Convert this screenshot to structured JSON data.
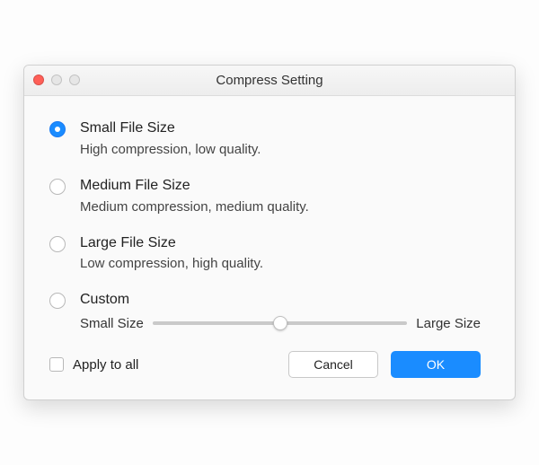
{
  "window": {
    "title": "Compress Setting"
  },
  "options": [
    {
      "label": "Small File Size",
      "desc": "High compression, low quality.",
      "selected": true
    },
    {
      "label": "Medium File Size",
      "desc": "Medium compression, medium quality.",
      "selected": false
    },
    {
      "label": "Large File Size",
      "desc": "Low compression, high quality.",
      "selected": false
    },
    {
      "label": "Custom",
      "desc": "",
      "selected": false
    }
  ],
  "custom_slider": {
    "left_label": "Small Size",
    "right_label": "Large Size"
  },
  "apply_to_all": {
    "label": "Apply to all",
    "checked": false
  },
  "buttons": {
    "cancel": "Cancel",
    "ok": "OK"
  }
}
